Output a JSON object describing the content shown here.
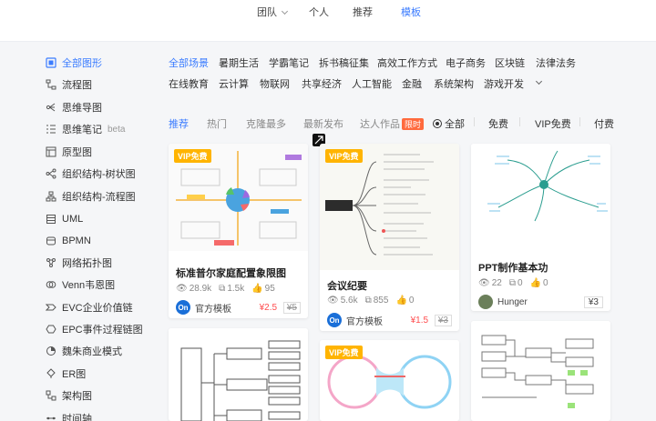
{
  "topnav": {
    "tabs": [
      {
        "label": "团队",
        "dropdown": true
      },
      {
        "label": "个人"
      },
      {
        "label": "推荐"
      },
      {
        "label": "模板",
        "active": true
      }
    ]
  },
  "sidebar": {
    "items": [
      {
        "label": "全部图形",
        "icon": "all-shapes-icon",
        "active": true
      },
      {
        "label": "流程图",
        "icon": "flowchart-icon"
      },
      {
        "label": "思维导图",
        "icon": "mindmap-icon"
      },
      {
        "label": "思维笔记",
        "icon": "notes-icon",
        "badge": "beta"
      },
      {
        "label": "原型图",
        "icon": "prototype-icon"
      },
      {
        "label": "组织结构-树状图",
        "icon": "org-tree-icon"
      },
      {
        "label": "组织结构-流程图",
        "icon": "org-flow-icon"
      },
      {
        "label": "UML",
        "icon": "uml-icon"
      },
      {
        "label": "BPMN",
        "icon": "bpmn-icon"
      },
      {
        "label": "网络拓扑图",
        "icon": "network-icon"
      },
      {
        "label": "Venn韦恩图",
        "icon": "venn-icon"
      },
      {
        "label": "EVC企业价值链",
        "icon": "evc-icon"
      },
      {
        "label": "EPC事件过程链图",
        "icon": "epc-icon"
      },
      {
        "label": "魏朱商业模式",
        "icon": "business-model-icon"
      },
      {
        "label": "ER图",
        "icon": "er-icon"
      },
      {
        "label": "架构图",
        "icon": "architecture-icon"
      },
      {
        "label": "时间轴",
        "icon": "timeline-icon"
      }
    ]
  },
  "scenes": {
    "row1": [
      "全部场景",
      "暑期生活",
      "学霸笔记",
      "拆书稿征集",
      "高效工作方式",
      "电子商务",
      "区块链",
      "法律法务"
    ],
    "row2": [
      "在线教育",
      "云计算",
      "物联网",
      "共享经济",
      "人工智能",
      "金融",
      "系统架构",
      "游戏开发"
    ]
  },
  "filters": {
    "sort": [
      "推荐",
      "热门",
      "克隆最多",
      "最新发布",
      "达人作品"
    ],
    "hot_badge": "限时",
    "price": [
      "全部",
      "免费",
      "VIP免费",
      "付费"
    ]
  },
  "cards": [
    {
      "title": "标准普尔家庭配置象限图",
      "vip": "VIP免费",
      "views": "28.9k",
      "clones": "1.5k",
      "likes": "95",
      "author": "官方模板",
      "avatar": "On",
      "price_now": "¥2.5",
      "price_old": "¥5"
    },
    {
      "title": "会议纪要",
      "vip": "VIP免费",
      "views": "5.6k",
      "clones": "855",
      "likes": "0",
      "author": "官方模板",
      "avatar": "On",
      "price_now": "¥1.5",
      "price_old": "¥3"
    },
    {
      "title": "PPT制作基本功",
      "views": "22",
      "clones": "0",
      "likes": "0",
      "author": "Hunger",
      "price": "¥3"
    },
    {
      "title": "",
      "vip": ""
    },
    {
      "title": "",
      "vip": "VIP免费"
    },
    {
      "title": ""
    }
  ],
  "colors": {
    "accent": "#3b7cff",
    "vip": "#ffb400",
    "hot": "#ff6a3d",
    "price": "#ff4d4f"
  }
}
